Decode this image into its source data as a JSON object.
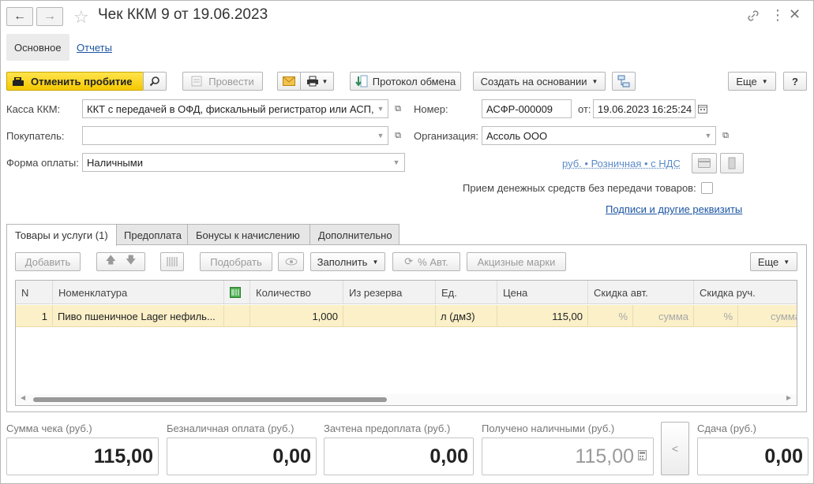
{
  "window": {
    "title": "Чек ККМ 9 от 19.06.2023"
  },
  "nav_tabs": [
    {
      "label": "Основное"
    },
    {
      "label": "Отчеты"
    }
  ],
  "toolbar": {
    "cancel_label": "Отменить пробитие",
    "post_label": "Провести",
    "protocol_label": "Протокол обмена",
    "create_based_label": "Создать на основании",
    "more_label": "Еще",
    "help_label": "?"
  },
  "form": {
    "kassa_label": "Касса ККМ:",
    "kassa_value": "ККТ с передачей в ОФД, фискальный регистратор или АСП, ",
    "number_label": "Номер:",
    "number_value": "АСФР-000009",
    "date_label": "от:",
    "date_value": "19.06.2023 16:25:24",
    "buyer_label": "Покупатель:",
    "buyer_value": "",
    "org_label": "Организация:",
    "org_value": "Ассоль ООО",
    "payment_label": "Форма оплаты:",
    "payment_value": "Наличными",
    "price_link": "руб. • Розничная • с НДС",
    "no_goods_label": "Прием денежных средств без передачи товаров:",
    "no_goods_checked": false,
    "signatures_link": "Подписи и другие реквизиты"
  },
  "tabs": [
    {
      "label": "Товары и услуги (1)"
    },
    {
      "label": "Предоплата"
    },
    {
      "label": "Бонусы к начислению"
    },
    {
      "label": "Дополнительно"
    }
  ],
  "table_toolbar": {
    "add_label": "Добавить",
    "pick_label": "Подобрать",
    "fill_label": "Заполнить",
    "auto_label": "% Авт.",
    "excise_label": "Акцизные марки",
    "more_label": "Еще"
  },
  "table": {
    "columns": [
      "N",
      "Номенклатура",
      "",
      "Количество",
      "Из резерва",
      "Ед.",
      "Цена",
      "Скидка авт.",
      "Скидка руч."
    ],
    "rows": [
      {
        "n": "1",
        "item": "Пиво пшеничное Lager нефиль...",
        "qty": "1,000",
        "reserve": "",
        "unit": "л (дм3)",
        "price": "115,00",
        "auto_pct": "%",
        "auto_sum": "сумма",
        "man_pct": "%",
        "man_sum": "сумма"
      }
    ]
  },
  "totals": {
    "sum_label": "Сумма чека (руб.)",
    "sum_value": "115,00",
    "noncash_label": "Безналичная оплата (руб.)",
    "noncash_value": "0,00",
    "prepay_label": "Зачтена предоплата (руб.)",
    "prepay_value": "0,00",
    "cash_label": "Получено наличными (руб.)",
    "cash_value": "115,00",
    "collapse_label": "<",
    "change_label": "Сдача (руб.)",
    "change_value": "0,00"
  },
  "colors": {
    "accent_yellow": "#f5c800",
    "link": "#1c55a3",
    "row_selected": "#fbf0c8"
  }
}
